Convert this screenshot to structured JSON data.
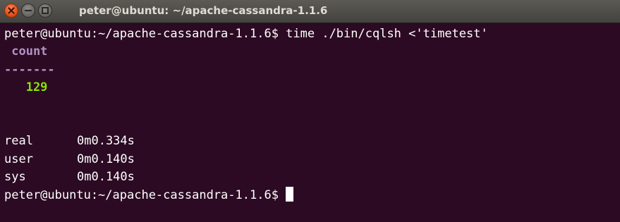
{
  "window": {
    "title": "peter@ubuntu: ~/apache-cassandra-1.1.6",
    "buttons": [
      "close-icon",
      "minimize-icon",
      "maximize-icon"
    ],
    "colors": {
      "terminal_bg": "#2c0a23",
      "titlebar_bg": "#4c4b47",
      "close_button": "#e0501c",
      "column_header": "#b392c4",
      "result_value": "#86e600",
      "text": "#ffffff"
    }
  },
  "terminal": {
    "command_line": "peter@ubuntu:~/apache-cassandra-1.1.6$ time ./bin/cqlsh <'timetest'",
    "result_header": " count",
    "result_separator": "-------",
    "result_value": "   129",
    "timing": [
      {
        "label": "real",
        "value": "0m0.334s"
      },
      {
        "label": "user",
        "value": "0m0.140s"
      },
      {
        "label": "sys",
        "value": "0m0.140s"
      }
    ],
    "final_prompt": "peter@ubuntu:~/apache-cassandra-1.1.6$ "
  }
}
